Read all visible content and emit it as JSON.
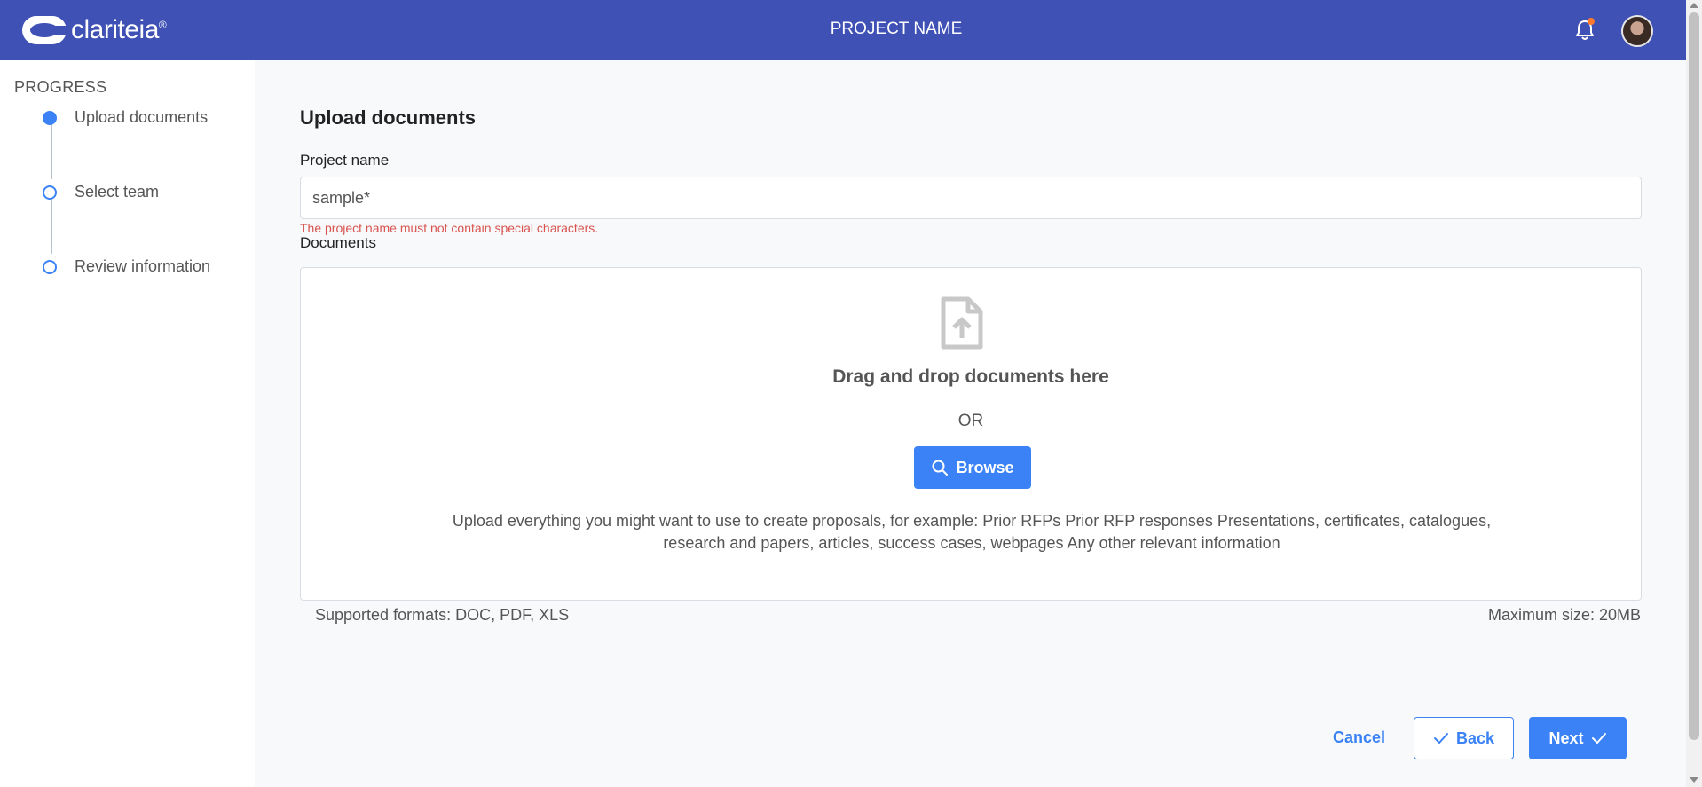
{
  "header": {
    "logo_text": "clariteia",
    "logo_tm": "®",
    "project_title": "PROJECT NAME",
    "notification_badge": true
  },
  "sidebar": {
    "title": "PROGRESS",
    "steps": [
      {
        "label": "Upload documents",
        "active": true
      },
      {
        "label": "Select team",
        "active": false
      },
      {
        "label": "Review information",
        "active": false
      }
    ]
  },
  "main": {
    "heading": "Upload documents",
    "project_name_label": "Project name",
    "project_name_value": "sample*",
    "project_name_error": "The project name must not contain special characters.",
    "documents_label": "Documents",
    "dropzone": {
      "title": "Drag and drop documents here",
      "or": "OR",
      "browse_label": "Browse",
      "description": "Upload everything you might want to use to create proposals, for example: Prior RFPs Prior RFP responses Presentations, certificates, catalogues, research and papers, articles, success cases, webpages Any other relevant information"
    },
    "supported_formats": "Supported formats: DOC, PDF, XLS",
    "max_size": "Maximum size: 20MB"
  },
  "footer": {
    "cancel_label": "Cancel",
    "back_label": "Back",
    "next_label": "Next"
  },
  "colors": {
    "header_bg": "#3f51b5",
    "accent": "#3b82f6",
    "error": "#d9534f",
    "notification_dot": "#ff7a2f"
  },
  "icons": {
    "bell": "bell-icon",
    "file_upload": "file-upload-icon",
    "search": "search-icon",
    "check": "check-icon"
  }
}
